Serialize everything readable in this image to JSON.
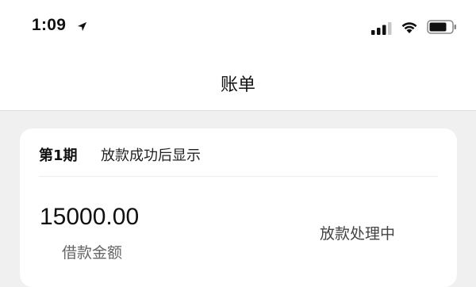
{
  "status_bar": {
    "time": "1:09"
  },
  "nav": {
    "title": "账单"
  },
  "bill": {
    "period": "第1期",
    "period_note": "放款成功后显示",
    "amount": "15000.00",
    "amount_label": "借款金额",
    "status": "放款处理中"
  }
}
